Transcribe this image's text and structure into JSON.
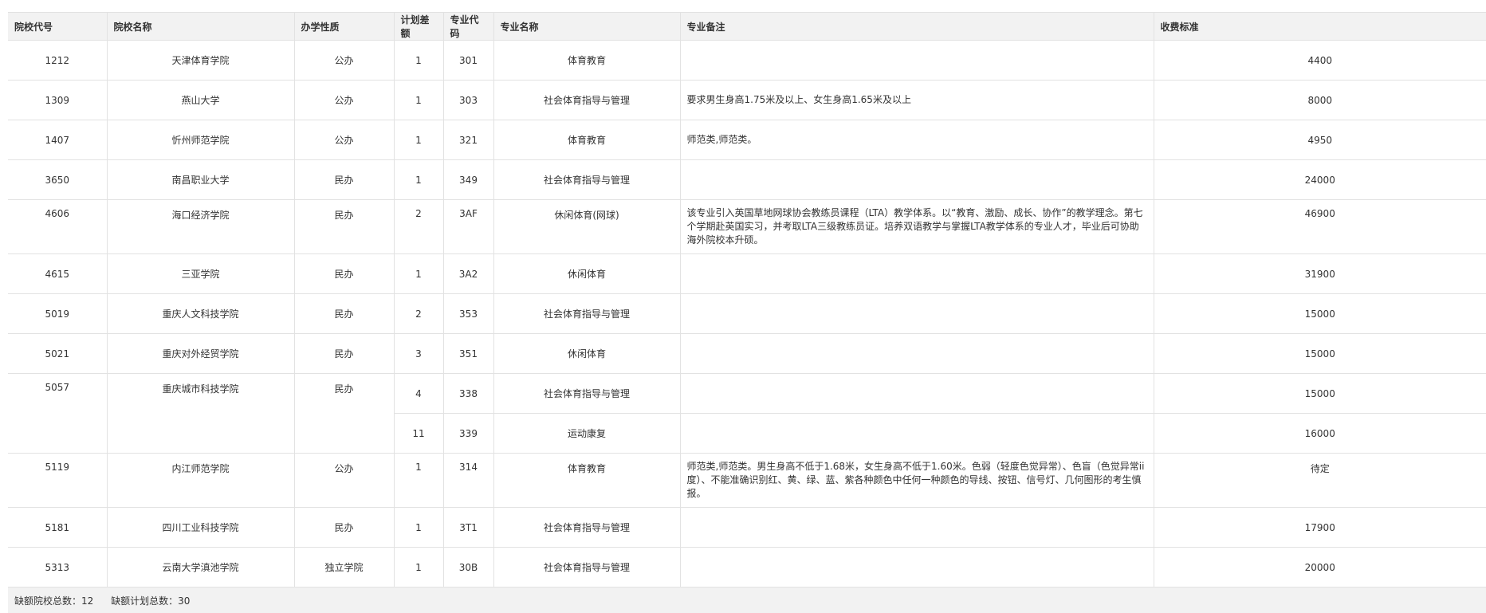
{
  "headers": [
    "院校代号",
    "院校名称",
    "办学性质",
    "计划差额",
    "专业代码",
    "专业名称",
    "专业备注",
    "收费标准"
  ],
  "rows": [
    {
      "code": "1212",
      "name": "天津体育学院",
      "type": "公办",
      "diff": "1",
      "major_code": "301",
      "major_name": "体育教育",
      "note": "",
      "fee": "4400"
    },
    {
      "code": "1309",
      "name": "燕山大学",
      "type": "公办",
      "diff": "1",
      "major_code": "303",
      "major_name": "社会体育指导与管理",
      "note": "要求男生身高1.75米及以上、女生身高1.65米及以上",
      "fee": "8000"
    },
    {
      "code": "1407",
      "name": "忻州师范学院",
      "type": "公办",
      "diff": "1",
      "major_code": "321",
      "major_name": "体育教育",
      "note": "师范类,师范类。",
      "fee": "4950"
    },
    {
      "code": "3650",
      "name": "南昌职业大学",
      "type": "民办",
      "diff": "1",
      "major_code": "349",
      "major_name": "社会体育指导与管理",
      "note": "",
      "fee": "24000"
    },
    {
      "code": "4606",
      "name": "海口经济学院",
      "type": "民办",
      "diff": "2",
      "major_code": "3AF",
      "major_name": "休闲体育(网球)",
      "note": "该专业引入英国草地网球协会教练员课程（LTA）教学体系。以“教育、激励、成长、协作”的教学理念。第七个学期赴英国实习，并考取LTA三级教练员证。培养双语教学与掌握LTA教学体系的专业人才，毕业后可协助海外院校本升硕。",
      "fee": "46900"
    },
    {
      "code": "4615",
      "name": "三亚学院",
      "type": "民办",
      "diff": "1",
      "major_code": "3A2",
      "major_name": "休闲体育",
      "note": "",
      "fee": "31900"
    },
    {
      "code": "5019",
      "name": "重庆人文科技学院",
      "type": "民办",
      "diff": "2",
      "major_code": "353",
      "major_name": "社会体育指导与管理",
      "note": "",
      "fee": "15000"
    },
    {
      "code": "5021",
      "name": "重庆对外经贸学院",
      "type": "民办",
      "diff": "3",
      "major_code": "351",
      "major_name": "休闲体育",
      "note": "",
      "fee": "15000"
    },
    {
      "code": "5057",
      "name": "重庆城市科技学院",
      "type": "民办",
      "diff": "4",
      "major_code": "338",
      "major_name": "社会体育指导与管理",
      "note": "",
      "fee": "15000"
    },
    {
      "diff": "11",
      "major_code": "339",
      "major_name": "运动康复",
      "note": "",
      "fee": "16000"
    },
    {
      "code": "5119",
      "name": "内江师范学院",
      "type": "公办",
      "diff": "1",
      "major_code": "314",
      "major_name": "体育教育",
      "note": "师范类,师范类。男生身高不低于1.68米，女生身高不低于1.60米。色弱（轻度色觉异常）、色盲（色觉异常ⅰⅰ度）、不能准确识别红、黄、绿、蓝、紫各种颜色中任何一种颜色的导线、按钮、信号灯、几何图形的考生慎报。",
      "fee": "待定"
    },
    {
      "code": "5181",
      "name": "四川工业科技学院",
      "type": "民办",
      "diff": "1",
      "major_code": "3T1",
      "major_name": "社会体育指导与管理",
      "note": "",
      "fee": "17900"
    },
    {
      "code": "5313",
      "name": "云南大学滇池学院",
      "type": "独立学院",
      "diff": "1",
      "major_code": "30B",
      "major_name": "社会体育指导与管理",
      "note": "",
      "fee": "20000"
    }
  ],
  "summary": {
    "schools_label": "缺额院校总数：",
    "schools_value": "12",
    "plans_label": "缺额计划总数：",
    "plans_value": "30"
  }
}
